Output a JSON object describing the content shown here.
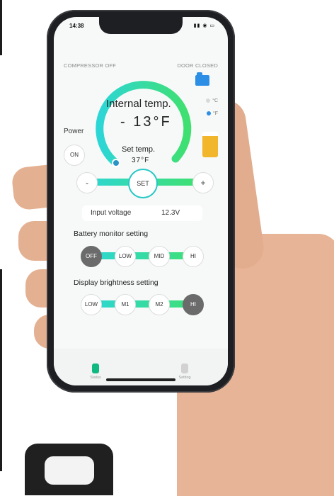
{
  "status_bar": {
    "time": "14:38",
    "icons": "▮▮ ◉ ▭"
  },
  "header": {
    "compressor_status": "COMPRESSOR OFF",
    "door_status": "DOOR CLOSED"
  },
  "units": {
    "celsius": "°C",
    "fahrenheit": "°F",
    "selected": "°F"
  },
  "temperature": {
    "internal_label": "Internal temp.",
    "internal_value": "- 13°F",
    "set_label": "Set temp.",
    "set_value": "37°F"
  },
  "power": {
    "label": "Power",
    "button": "ON"
  },
  "controls": {
    "minus": "-",
    "set": "SET",
    "plus": "+"
  },
  "voltage": {
    "label": "Input voltage",
    "value": "12.3V"
  },
  "battery_monitor": {
    "title": "Battery monitor setting",
    "options": [
      "OFF",
      "LOW",
      "MID",
      "HI"
    ],
    "selected": "OFF"
  },
  "display_brightness": {
    "title": "Display brightness setting",
    "options": [
      "LOW",
      "M1",
      "M2",
      "HI"
    ],
    "selected": "HI"
  },
  "bottom_nav": {
    "status": "Status",
    "setting": "Setting"
  },
  "colors": {
    "accent_teal": "#2dd6d6",
    "accent_green": "#3fe070",
    "door_blue": "#2c8ee5",
    "selected_gray": "#6b6b6b"
  }
}
